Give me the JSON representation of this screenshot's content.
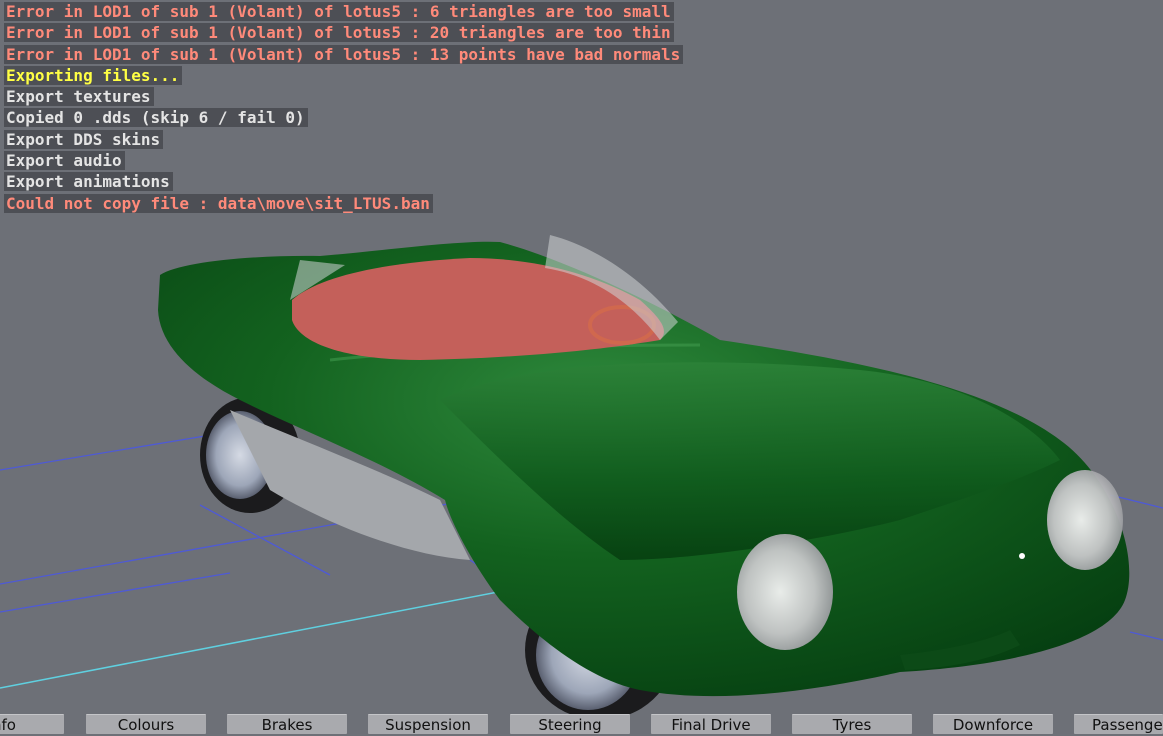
{
  "log": [
    {
      "text": "Error in LOD1 of sub 1 (Volant) of lotus5 : 6 triangles are too small",
      "color": "#ff8a7a"
    },
    {
      "text": "Error in LOD1 of sub 1 (Volant) of lotus5 : 20 triangles are too thin",
      "color": "#ff8a7a"
    },
    {
      "text": "Error in LOD1 of sub 1 (Volant) of lotus5 : 13 points have bad normals",
      "color": "#ff8a7a"
    },
    {
      "text": "Exporting files...",
      "color": "#ffff44"
    },
    {
      "text": "Export textures",
      "color": "#e4e4e4"
    },
    {
      "text": "Copied 0 .dds (skip 6 / fail 0)",
      "color": "#e4e4e4"
    },
    {
      "text": "Export DDS skins",
      "color": "#e4e4e4"
    },
    {
      "text": "Export audio",
      "color": "#e4e4e4"
    },
    {
      "text": "Export animations",
      "color": "#e4e4e4"
    },
    {
      "text": "Could not copy file : data\\move\\sit_LTUS.ban",
      "color": "#ff8a7a"
    }
  ],
  "tabs": [
    {
      "id": "info",
      "label": "nfo"
    },
    {
      "id": "colours",
      "label": "Colours"
    },
    {
      "id": "brakes",
      "label": "Brakes"
    },
    {
      "id": "suspension",
      "label": "Suspension"
    },
    {
      "id": "steering",
      "label": "Steering"
    },
    {
      "id": "final-drive",
      "label": "Final Drive"
    },
    {
      "id": "tyres",
      "label": "Tyres"
    },
    {
      "id": "downforce",
      "label": "Downforce"
    },
    {
      "id": "passengers",
      "label": "Passenge"
    }
  ],
  "colors": {
    "background": "#6d7077",
    "body": "#0f5a1c",
    "grid_blue": "#4e5ad6",
    "grid_cyan": "#5fd0e0",
    "interior": "#c4605a"
  }
}
